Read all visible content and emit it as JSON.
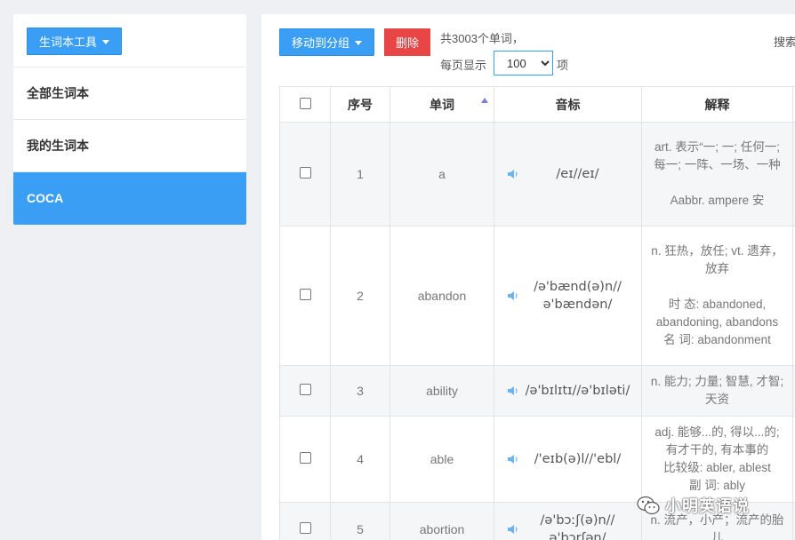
{
  "sidebar": {
    "tool_button": "生词本工具",
    "items": [
      {
        "label": "全部生词本"
      },
      {
        "label": "我的生词本"
      },
      {
        "label": "COCA"
      }
    ]
  },
  "toolbar": {
    "move_button": "移动到分组",
    "delete_button": "删除",
    "total_text": "共3003个单词，",
    "perpage_label": "每页显示",
    "perpage_value": "100",
    "perpage_unit": "项",
    "search_label": "搜索"
  },
  "table": {
    "headers": {
      "no": "序号",
      "word": "单词",
      "phonetic": "音标",
      "definition": "解释"
    },
    "rows": [
      {
        "no": "1",
        "word": "a",
        "phonetic": "/eɪ//eɪ/",
        "def": [
          "art. 表示“一; 一; 任何一; 每一; 一阵、一场、一种",
          "",
          "Aabbr. ampere 安"
        ]
      },
      {
        "no": "2",
        "word": "abandon",
        "phonetic": "/ə'bænd(ə)n// ə'bændən/",
        "def": [
          "n. 狂热，放任; vt. 遗弃，放弃",
          "",
          "时 态: abandoned, abandoning, abandons",
          "名 词: abandonment"
        ]
      },
      {
        "no": "3",
        "word": "ability",
        "phonetic": "/ə'bɪlɪtɪ//ə'bɪləti/",
        "def": [
          "n. 能力; 力量; 智慧, 才智; 天资"
        ]
      },
      {
        "no": "4",
        "word": "able",
        "phonetic": "/'eɪb(ə)l//'ebl/",
        "def": [
          "adj. 能够...的, 得以...的; 有才干的, 有本事的",
          "比较级: abler, ablest",
          "副 词: ably"
        ]
      },
      {
        "no": "5",
        "word": "abortion",
        "phonetic": "/ə'bɔːʃ(ə)n// ə'bɔrʃən/",
        "def": [
          "n. 流产，小产；流产的胎儿"
        ]
      }
    ]
  },
  "watermark": "小明英语说",
  "colors": {
    "accent": "#3a9ef5",
    "danger": "#e84646",
    "background": "#eef0f4"
  }
}
